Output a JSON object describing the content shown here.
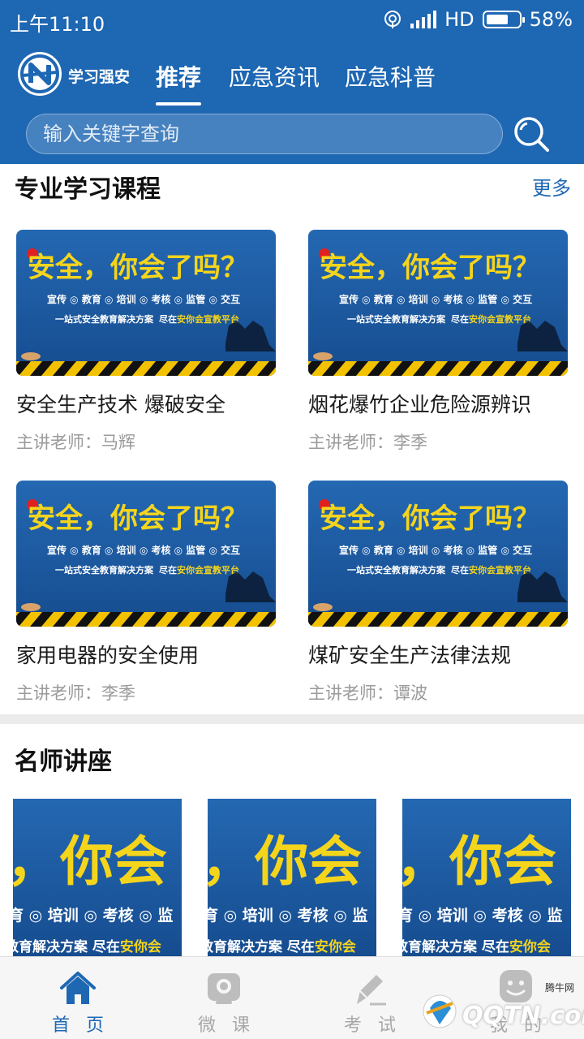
{
  "status_bar": {
    "time": "上午11:10",
    "network": "HD",
    "battery": "58%"
  },
  "header": {
    "brand": "学习强安",
    "tabs": [
      {
        "label": "推荐",
        "active": true
      },
      {
        "label": "应急资讯",
        "active": false
      },
      {
        "label": "应急科普",
        "active": false
      }
    ],
    "search": {
      "placeholder": "输入关键字查询"
    }
  },
  "courses": {
    "title": "专业学习课程",
    "more": "更多",
    "items": [
      {
        "title": "安全生产技术 爆破安全",
        "teacher": "主讲老师：马辉"
      },
      {
        "title": "烟花爆竹企业危险源辨识",
        "teacher": "主讲老师：李季"
      },
      {
        "title": "家用电器的安全使用",
        "teacher": "主讲老师：李季"
      },
      {
        "title": "煤矿安全生产法律法规",
        "teacher": "主讲老师：谭波"
      }
    ]
  },
  "poster": {
    "headline": "安全，你会了吗？",
    "tags": "宣传 ◎ 教育 ◎ 培训 ◎ 考核 ◎ 监管 ◎ 交互",
    "slogan_left": "一站式安全教育解决方案",
    "slogan_right_prefix": "尽在",
    "slogan_right_brand": "安你会宣教平台"
  },
  "lectures": {
    "title": "名师讲座",
    "poster_big": "，你会",
    "poster_tags": "育 ◎ 培训 ◎ 考核 ◎ 监",
    "poster_slogan": "教育解决方案  尽在",
    "poster_brand": "安你会"
  },
  "bottom_nav": [
    {
      "label": "首页",
      "icon": "home-icon",
      "active": true
    },
    {
      "label": "微课",
      "icon": "camera-icon",
      "active": false
    },
    {
      "label": "考试",
      "icon": "pen-icon",
      "active": false
    },
    {
      "label": "我的",
      "icon": "user-icon",
      "active": false
    }
  ],
  "watermark": {
    "text": "QQTN.com",
    "small": "腾牛网"
  },
  "colors": {
    "primary": "#1e67b3",
    "poster_bg": "#1d5fa8",
    "poster_yellow": "#f5d51c"
  }
}
